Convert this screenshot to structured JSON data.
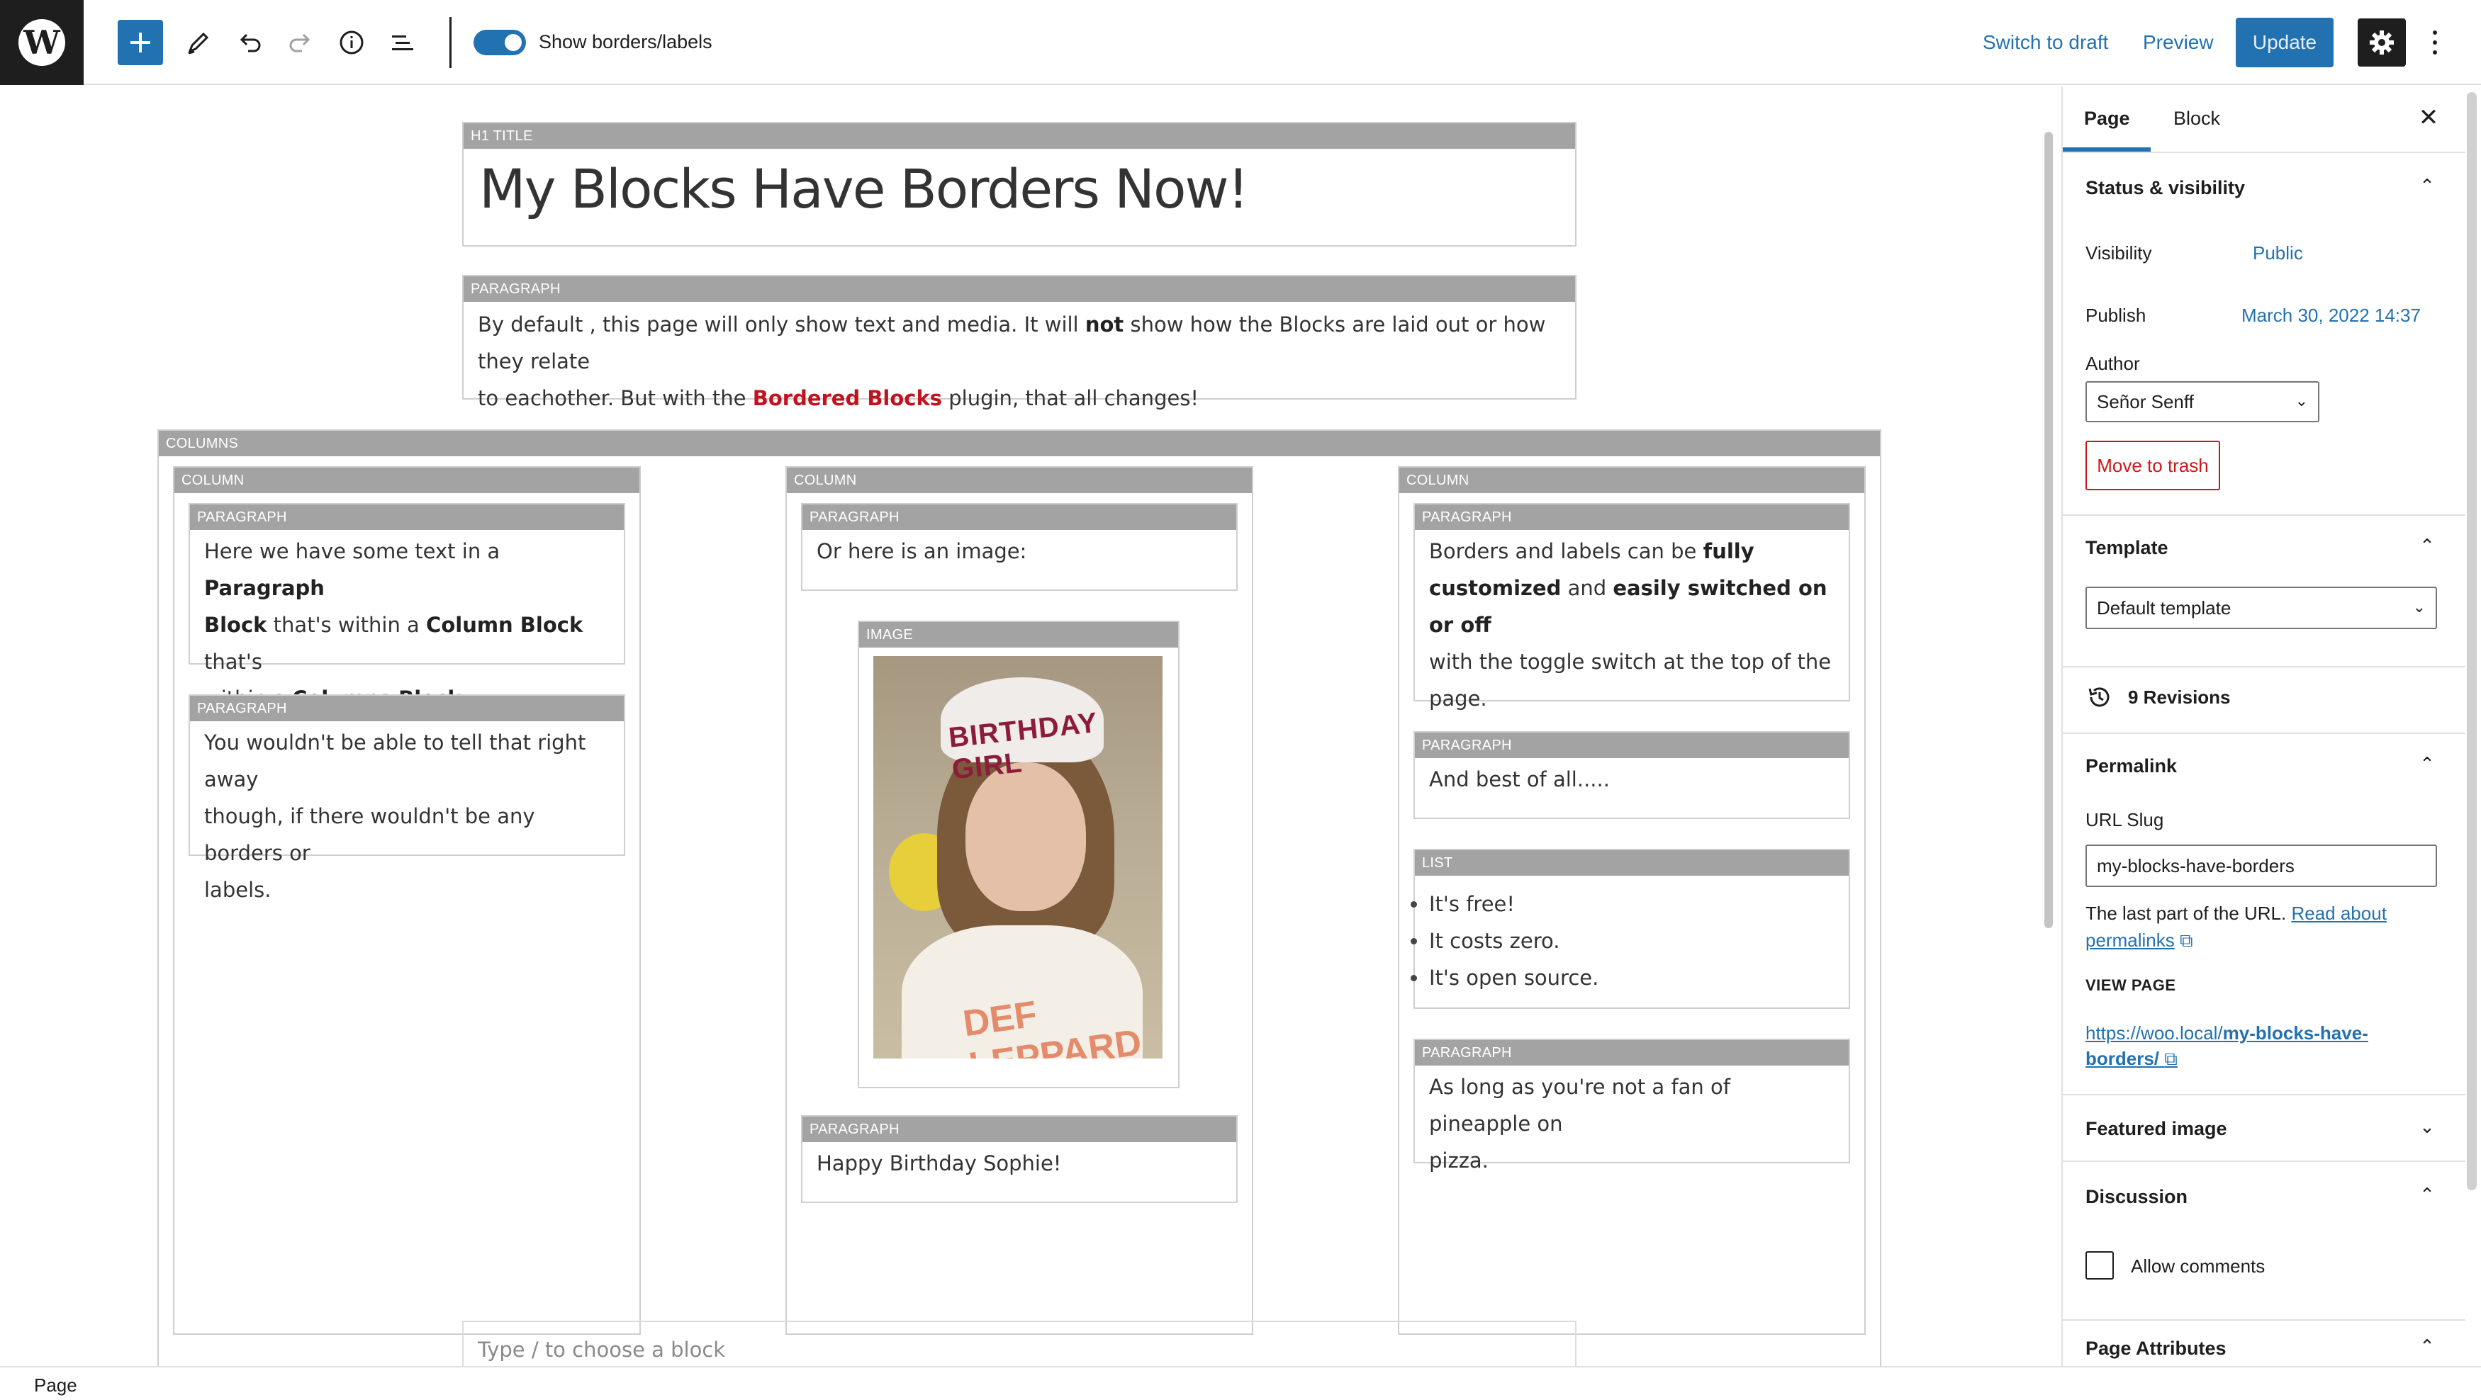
{
  "toolbar": {
    "toggle_label": "Show borders/labels",
    "switch_to_draft": "Switch to draft",
    "preview": "Preview",
    "update": "Update"
  },
  "editor": {
    "title_block": {
      "label": "H1 TITLE",
      "text": "My Blocks Have Borders Now!"
    },
    "intro_block": {
      "label": "PARAGRAPH",
      "line1_a": "By default , this page will only show text and media. It will ",
      "line1_bold": "not",
      "line1_b": " show how the Blocks are laid out or how they relate",
      "line2_a": "to eachother. But with the ",
      "line2_red": "Bordered Blocks",
      "line2_b": " plugin, that all changes!"
    },
    "columns_label": "COLUMNS",
    "column_label": "COLUMN",
    "col1": {
      "p1": {
        "label": "PARAGRAPH",
        "t1": "Here we have some text in a ",
        "b1": "Paragraph",
        "b2": "Block",
        "t2": " that's within a ",
        "b3": "Column Block",
        "t3": " that's",
        "t4": "within a ",
        "b4": "Columns Block",
        "t5": "."
      },
      "p2": {
        "label": "PARAGRAPH",
        "l1": "You wouldn't be able to tell that right away",
        "l2": "though, if there wouldn't be any borders or",
        "l3": "labels."
      }
    },
    "col2": {
      "p1": {
        "label": "PARAGRAPH",
        "text": "Or here is an image:"
      },
      "image": {
        "label": "IMAGE",
        "crown_text": "BIRTHDAY GIRL",
        "shirt_text": "DEF LEPPARD"
      },
      "p2": {
        "label": "PARAGRAPH",
        "text": "Happy Birthday Sophie!"
      }
    },
    "col3": {
      "p1": {
        "label": "PARAGRAPH",
        "t1": "Borders and labels can be ",
        "b1": "fully",
        "b2": "customized",
        "t2": " and ",
        "b3": "easily switched on or off",
        "t3": "with the toggle switch at the top of the",
        "t4": "page."
      },
      "p2": {
        "label": "PARAGRAPH",
        "text": "And best of all....."
      },
      "list": {
        "label": "LIST",
        "items": [
          "It's free!",
          "It costs zero.",
          "It's open source."
        ]
      },
      "p3": {
        "label": "PARAGRAPH",
        "l1": "As long as you're not a fan of pineapple on",
        "l2": "pizza."
      }
    },
    "inserter_placeholder": "Type / to choose a block"
  },
  "sidebar": {
    "tab_page": "Page",
    "tab_block": "Block",
    "status": {
      "heading": "Status & visibility",
      "visibility_label": "Visibility",
      "visibility_value": "Public",
      "publish_label": "Publish",
      "publish_value": "March 30, 2022 14:37",
      "author_label": "Author",
      "author_value": "Señor Senff",
      "trash": "Move to trash"
    },
    "template": {
      "heading": "Template",
      "value": "Default template"
    },
    "revisions": "9 Revisions",
    "permalink": {
      "heading": "Permalink",
      "slug_label": "URL Slug",
      "slug_value": "my-blocks-have-borders",
      "help_text": "The last part of the URL. ",
      "help_link_1": "Read about",
      "help_link_2": "permalinks",
      "view_page": "VIEW PAGE",
      "url_base": "https://woo.local/",
      "url_bold_1": "my-blocks-have-",
      "url_bold_2": "borders/"
    },
    "featured_image": "Featured image",
    "discussion": {
      "heading": "Discussion",
      "allow_comments": "Allow comments"
    },
    "page_attributes": "Page Attributes"
  },
  "statusbar": {
    "breadcrumb": "Page"
  },
  "colors": {
    "accent": "#2271b1",
    "label_bg": "#a3a3a3",
    "danger": "#cc1818",
    "highlight": "#c1121f"
  },
  "icons": [
    "wordpress-logo-icon",
    "plus-icon",
    "pencil-icon",
    "undo-icon",
    "redo-icon",
    "info-icon",
    "list-view-icon",
    "gear-icon",
    "more-vertical-icon",
    "close-icon",
    "chevron-up-icon",
    "chevron-down-icon",
    "history-icon",
    "external-link-icon"
  ]
}
